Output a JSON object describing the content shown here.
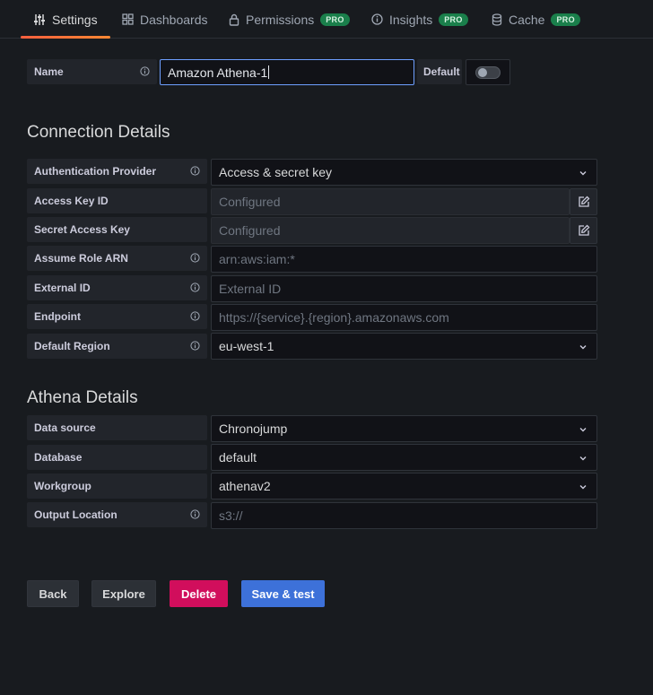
{
  "tabs": [
    {
      "label": "Settings",
      "icon": "sliders-icon",
      "active": true
    },
    {
      "label": "Dashboards",
      "icon": "apps-icon",
      "pro": false
    },
    {
      "label": "Permissions",
      "icon": "lock-icon",
      "pro": true
    },
    {
      "label": "Insights",
      "icon": "info-circle-icon",
      "pro": true
    },
    {
      "label": "Cache",
      "icon": "database-icon",
      "pro": true
    }
  ],
  "pro_badge": "PRO",
  "name_field": {
    "label": "Name",
    "value": "Amazon Athena-1",
    "default_label": "Default",
    "default_on": false
  },
  "connection": {
    "title": "Connection Details",
    "auth_provider": {
      "label": "Authentication Provider",
      "value": "Access & secret key"
    },
    "access_key": {
      "label": "Access Key ID",
      "value": "Configured"
    },
    "secret_key": {
      "label": "Secret Access Key",
      "value": "Configured"
    },
    "assume_role": {
      "label": "Assume Role ARN",
      "placeholder": "arn:aws:iam:*"
    },
    "external_id": {
      "label": "External ID",
      "placeholder": "External ID"
    },
    "endpoint": {
      "label": "Endpoint",
      "placeholder": "https://{service}.{region}.amazonaws.com"
    },
    "region": {
      "label": "Default Region",
      "value": "eu-west-1"
    }
  },
  "athena": {
    "title": "Athena Details",
    "data_source": {
      "label": "Data source",
      "value": "Chronojump"
    },
    "database": {
      "label": "Database",
      "value": "default"
    },
    "workgroup": {
      "label": "Workgroup",
      "value": "athenav2"
    },
    "output_location": {
      "label": "Output Location",
      "placeholder": "s3://"
    }
  },
  "buttons": {
    "back": "Back",
    "explore": "Explore",
    "delete": "Delete",
    "save": "Save & test"
  },
  "colors": {
    "background": "#181b1f",
    "accent": "#ff8833",
    "primary": "#3d71d9",
    "danger": "#d10e5c",
    "pro": "#1a7f4b"
  }
}
